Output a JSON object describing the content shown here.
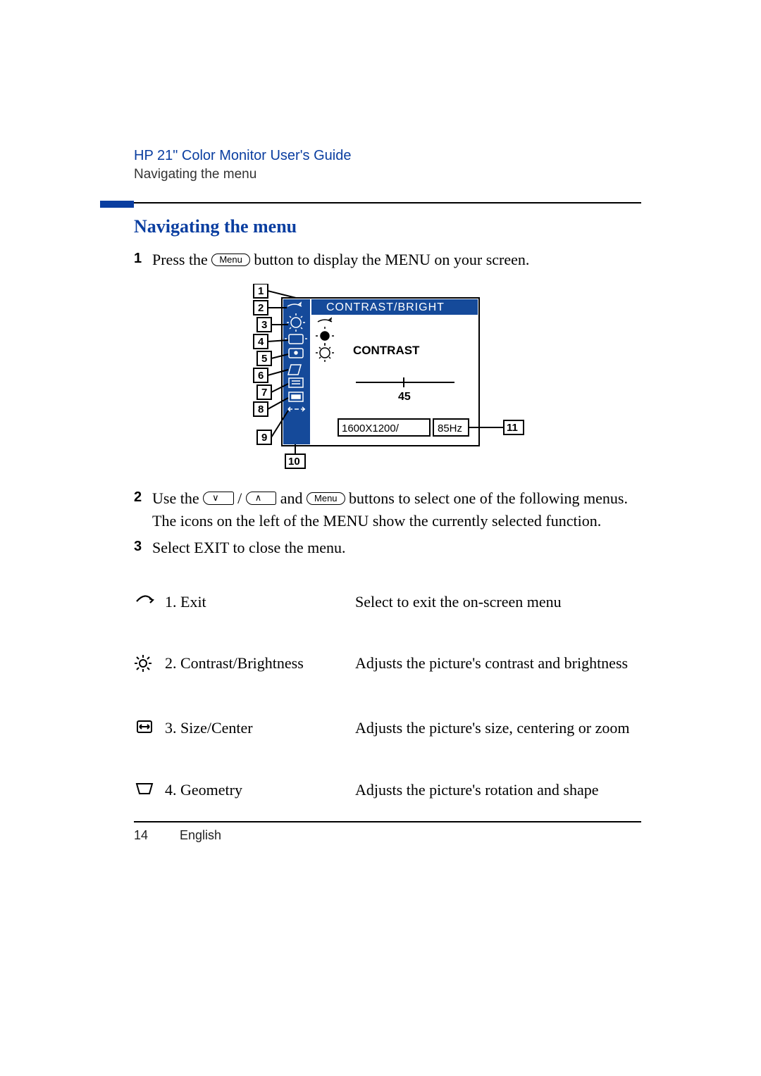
{
  "header": {
    "title": "HP 21\" Color Monitor User's Guide",
    "subtitle": "Navigating the menu"
  },
  "section_title": "Navigating the menu",
  "steps": {
    "s1": {
      "num": "1",
      "text_a": "Press the ",
      "btn": "Menu",
      "text_b": " button to display the MENU on your screen."
    },
    "s2": {
      "num": "2",
      "text_a": "Use the ",
      "btn_down": "∨",
      "sep": " / ",
      "btn_up": "∧",
      "text_b": " and ",
      "btn_menu": "Menu",
      "text_c": " buttons to select one of the following menus. The icons on the left of the MENU show the currently selected function."
    },
    "s3": {
      "num": "3",
      "text": "Select EXIT to close the menu."
    }
  },
  "osd": {
    "title": "CONTRAST/BRIGHT",
    "item": "CONTRAST",
    "value": "45",
    "status_res": "1600X1200/",
    "status_hz": "85Hz",
    "labels": {
      "l1": "1",
      "l2": "2",
      "l3": "3",
      "l4": "4",
      "l5": "5",
      "l6": "6",
      "l7": "7",
      "l8": "8",
      "l9": "9",
      "l10": "10",
      "l11": "11"
    }
  },
  "menu_items": [
    {
      "label": "1. Exit",
      "desc": "Select to exit the on-screen menu"
    },
    {
      "label": "2. Contrast/Brightness",
      "desc": "Adjusts the picture's contrast and brightness"
    },
    {
      "label": "3. Size/Center",
      "desc": "Adjusts the picture's size, centering or zoom"
    },
    {
      "label": "4. Geometry",
      "desc": "Adjusts the picture's rotation and shape"
    }
  ],
  "footer": {
    "page": "14",
    "lang": "English"
  }
}
